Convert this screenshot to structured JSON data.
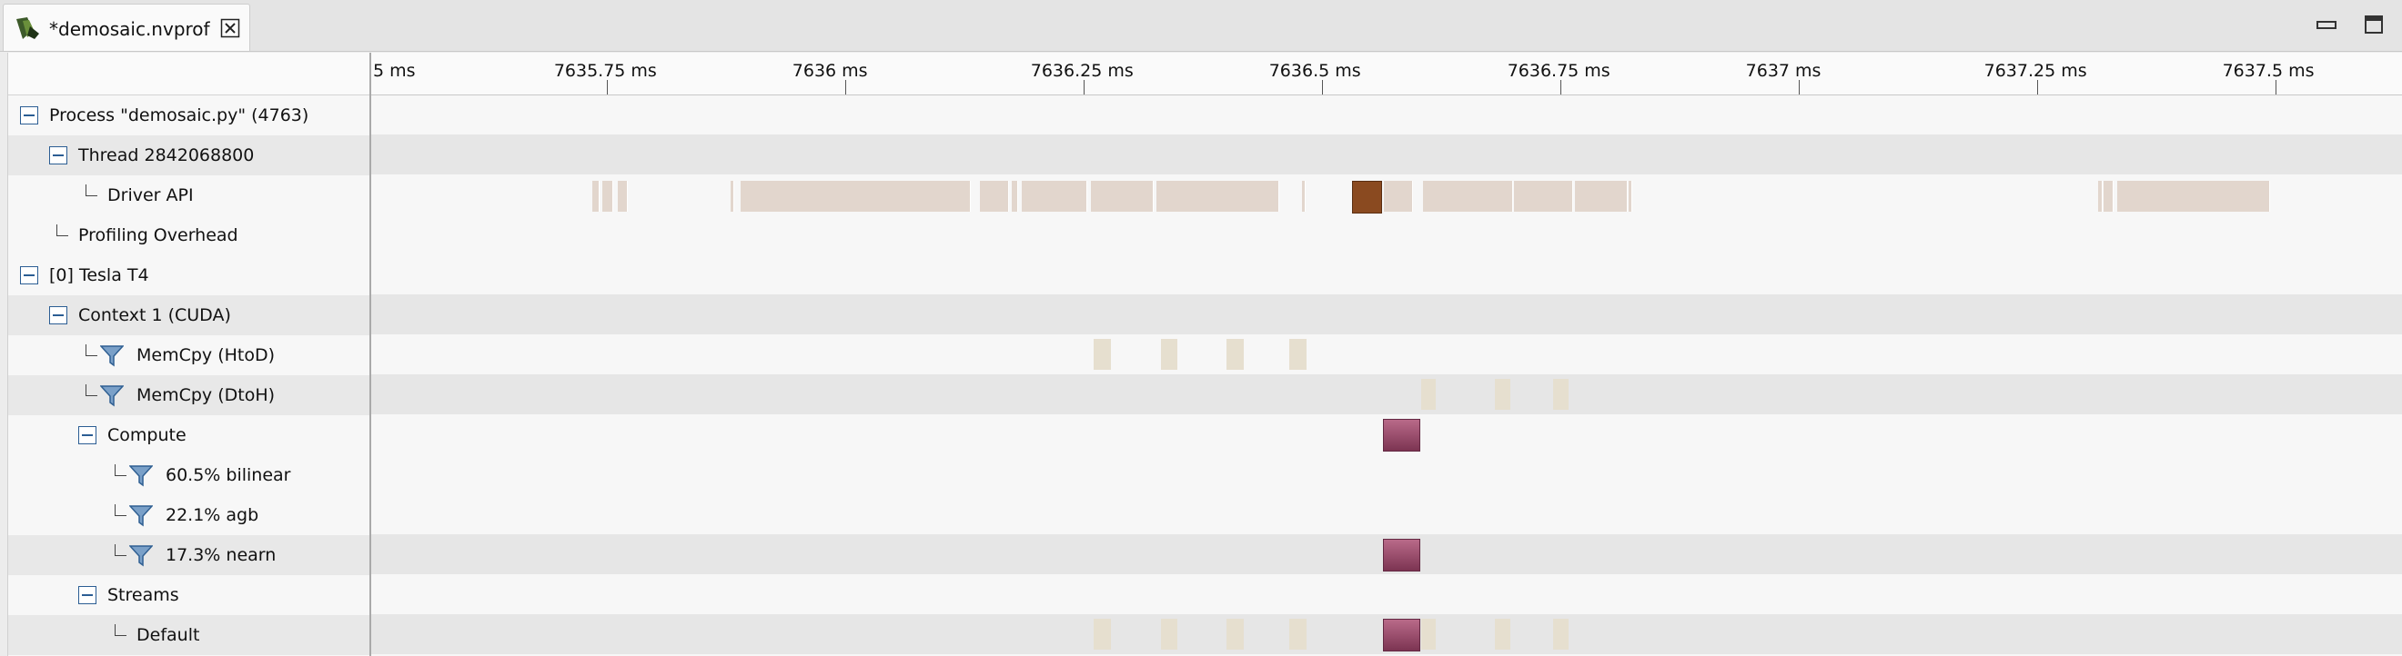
{
  "tab": {
    "title": "*demosaic.nvprof",
    "icon": "nvprof-file-icon",
    "close_icon": "close-tab-icon"
  },
  "window_controls": {
    "minimize": "minimize-icon",
    "maximize": "maximize-icon"
  },
  "ruler": {
    "labels": [
      "5 ms",
      "7635.75 ms",
      "7636 ms",
      "7636.25 ms",
      "7636.5 ms",
      "7636.75 ms",
      "7637 ms",
      "7637.25 ms",
      "7637.5 ms"
    ]
  },
  "tree": {
    "rows": [
      {
        "label": "Process \"demosaic.py\" (4763)",
        "control": "collapse"
      },
      {
        "label": "Thread 2842068800",
        "control": "collapse"
      },
      {
        "label": "Driver API",
        "control": "branch"
      },
      {
        "label": "Profiling Overhead",
        "control": "branch"
      },
      {
        "label": "[0] Tesla T4",
        "control": "collapse"
      },
      {
        "label": "Context 1 (CUDA)",
        "control": "collapse"
      },
      {
        "label": "MemCpy (HtoD)",
        "control": "filter"
      },
      {
        "label": "MemCpy (DtoH)",
        "control": "filter"
      },
      {
        "label": "Compute",
        "control": "collapse"
      },
      {
        "label": "60.5% bilinear",
        "control": "filter"
      },
      {
        "label": "22.1% agb",
        "control": "filter"
      },
      {
        "label": "17.3% nearn",
        "control": "filter"
      },
      {
        "label": "Streams",
        "control": "collapse"
      },
      {
        "label": "Default",
        "control": "branch"
      }
    ]
  },
  "colors": {
    "api_call": "#e2d6cd",
    "api_selected": "#8a4a20",
    "memcpy": "#e6dfcf",
    "kernel": "#9b4a6b",
    "tree_icon": "#2b5d93"
  },
  "timeline": {
    "unit": "ms",
    "visible_range": [
      7635.503,
      7637.634
    ],
    "lanes": {
      "driver_api": [
        [
          7635.735,
          7635.742
        ],
        [
          7635.745,
          7635.756
        ],
        [
          7635.762,
          7635.771
        ],
        [
          7635.88,
          7635.883
        ],
        [
          7635.89,
          7636.131
        ],
        [
          7636.141,
          7636.171
        ],
        [
          7636.175,
          7636.181
        ],
        [
          7636.185,
          7636.253
        ],
        [
          7636.258,
          7636.323
        ],
        [
          7636.327,
          7636.454
        ],
        [
          7636.479,
          7636.481
        ],
        [
          7637.314,
          7637.318
        ],
        [
          7637.32,
          7637.33
        ],
        [
          7637.334,
          7637.494
        ],
        [
          7636.565,
          7636.595
        ],
        [
          7636.606,
          7636.7
        ],
        [
          7636.702,
          7636.763
        ],
        [
          7636.766,
          7636.82
        ],
        [
          7636.822,
          7636.825
        ]
      ],
      "driver_api_selected": [
        [
          7636.532,
          7636.561
        ]
      ],
      "memcpy_htod": [
        [
          7636.261,
          7636.279
        ],
        [
          7636.331,
          7636.349
        ],
        [
          7636.4,
          7636.418
        ],
        [
          7636.466,
          7636.484
        ]
      ],
      "memcpy_dtoh": [
        [
          7636.604,
          7636.62
        ],
        [
          7636.682,
          7636.698
        ],
        [
          7636.743,
          7636.759
        ]
      ],
      "compute": [
        [
          7636.564,
          7636.601
        ]
      ],
      "kernel_nearn": [
        [
          7636.564,
          7636.601
        ]
      ],
      "default_stream_memcpy": [
        [
          7636.261,
          7636.279
        ],
        [
          7636.331,
          7636.349
        ],
        [
          7636.4,
          7636.418
        ],
        [
          7636.466,
          7636.484
        ],
        [
          7636.604,
          7636.62
        ],
        [
          7636.682,
          7636.698
        ],
        [
          7636.743,
          7636.759
        ]
      ],
      "default_stream_kernel": [
        [
          7636.564,
          7636.601
        ]
      ]
    }
  }
}
